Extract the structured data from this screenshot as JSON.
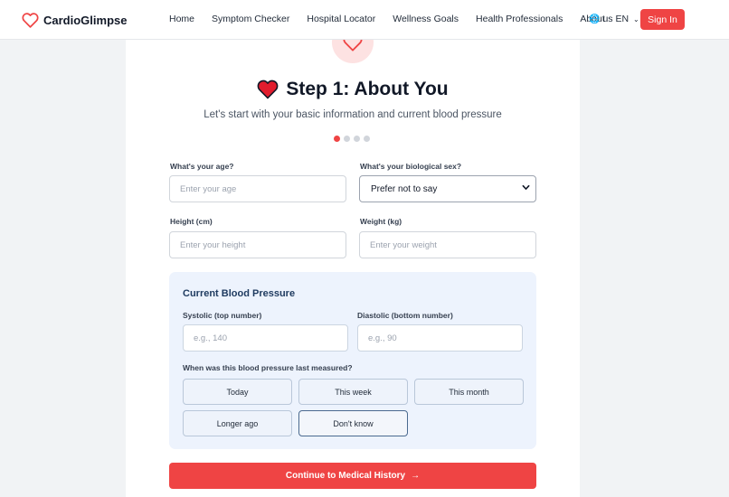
{
  "nav": {
    "brand": "CardioGlimpse",
    "links": [
      "Home",
      "Symptom Checker",
      "Hospital Locator",
      "Wellness Goals",
      "Health Professionals",
      "About"
    ],
    "language": "us EN",
    "signin": "Sign In"
  },
  "step": {
    "title": "Step 1: About You",
    "subtitle": "Let's start with your basic information and current blood pressure",
    "progress": {
      "current": 1,
      "total": 4
    }
  },
  "form": {
    "age": {
      "label": "What's your age?",
      "placeholder": "Enter your age"
    },
    "sex": {
      "label": "What's your biological sex?",
      "value": "Prefer not to say"
    },
    "height": {
      "label": "Height (cm)",
      "placeholder": "Enter your height"
    },
    "weight": {
      "label": "Weight (kg)",
      "placeholder": "Enter your weight"
    }
  },
  "bp": {
    "title": "Current Blood Pressure",
    "systolic": {
      "label": "Systolic (top number)",
      "placeholder": "e.g., 140"
    },
    "diastolic": {
      "label": "Diastolic (bottom number)",
      "placeholder": "e.g., 90"
    },
    "question": "When was this blood pressure last measured?",
    "options": [
      "Today",
      "This week",
      "This month",
      "Longer ago",
      "Don't know"
    ],
    "selected": "Don't know"
  },
  "continue_label": "Continue to Medical History",
  "colors": {
    "accent": "#ef4444",
    "panel": "#edf3fd",
    "panel_title": "#1e3a5f"
  }
}
